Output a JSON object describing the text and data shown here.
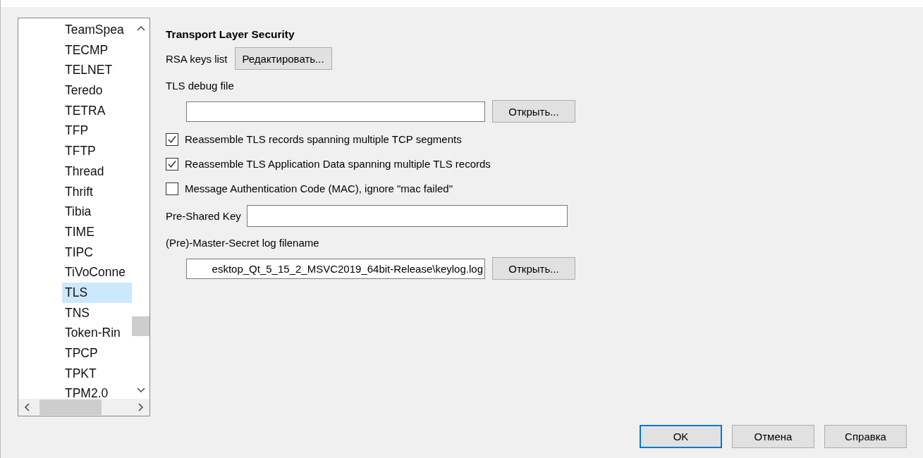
{
  "protocol_list": {
    "items": [
      {
        "label": "TeamSpea",
        "selected": false
      },
      {
        "label": "TECMP",
        "selected": false
      },
      {
        "label": "TELNET",
        "selected": false
      },
      {
        "label": "Teredo",
        "selected": false
      },
      {
        "label": "TETRA",
        "selected": false
      },
      {
        "label": "TFP",
        "selected": false
      },
      {
        "label": "TFTP",
        "selected": false
      },
      {
        "label": "Thread",
        "selected": false
      },
      {
        "label": "Thrift",
        "selected": false
      },
      {
        "label": "Tibia",
        "selected": false
      },
      {
        "label": "TIME",
        "selected": false
      },
      {
        "label": "TIPC",
        "selected": false
      },
      {
        "label": "TiVoConne",
        "selected": false
      },
      {
        "label": "TLS",
        "selected": true
      },
      {
        "label": "TNS",
        "selected": false
      },
      {
        "label": "Token-Rin",
        "selected": false
      },
      {
        "label": "TPCP",
        "selected": false
      },
      {
        "label": "TPKT",
        "selected": false
      },
      {
        "label": "TPM2.0",
        "selected": false
      }
    ]
  },
  "settings": {
    "title": "Transport Layer Security",
    "rsa_keys": {
      "label": "RSA keys list",
      "button": "Редактировать..."
    },
    "debug_file": {
      "label": "TLS debug file",
      "button": "Открыть..."
    },
    "options": [
      {
        "label": "Reassemble TLS records spanning multiple TCP segments",
        "checked": true
      },
      {
        "label": "Reassemble TLS Application Data spanning multiple TLS records",
        "checked": true
      },
      {
        "label": "Message Authentication Code (MAC), ignore \"mac failed\"",
        "checked": false
      }
    ],
    "psk": {
      "label": "Pre-Shared Key"
    },
    "master_secret": {
      "label": "(Pre)-Master-Secret log filename",
      "value": "esktop_Qt_5_15_2_MSVC2019_64bit-Release\\keylog.log",
      "button": "Открыть..."
    }
  },
  "buttons": [
    {
      "label": "OK",
      "selected": true
    },
    {
      "label": "Отмена",
      "selected": false
    },
    {
      "label": "Справка",
      "selected": false
    }
  ]
}
